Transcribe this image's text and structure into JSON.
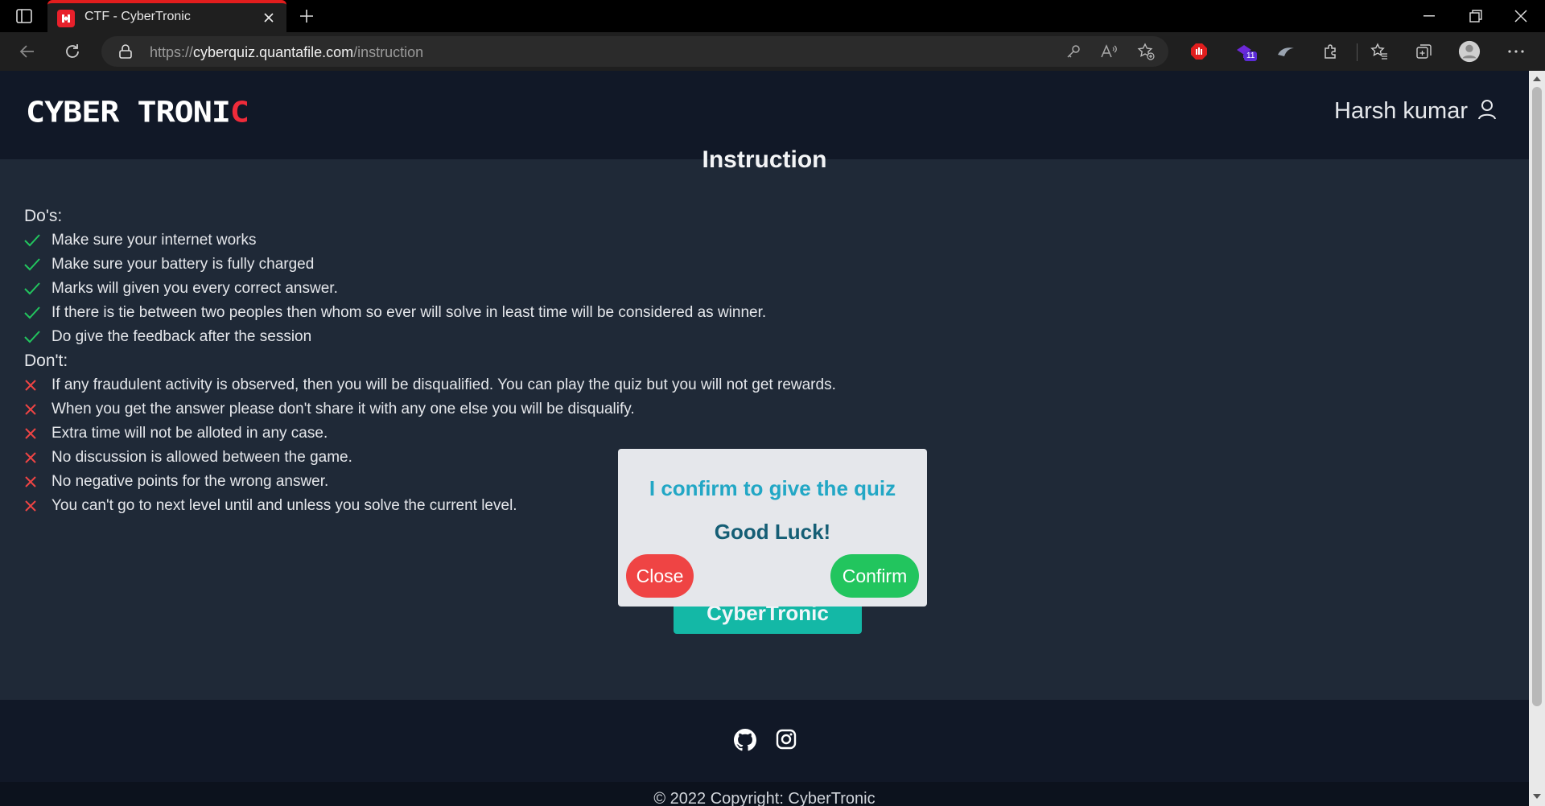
{
  "browser": {
    "tab_title": "CTF - CyberTronic",
    "url_scheme": "https://",
    "url_host": "cyberquiz.quantafile.com",
    "url_path": "/instruction",
    "extension_badge": "11"
  },
  "header": {
    "logo_white": "CYBER TRONI",
    "logo_red": "C",
    "user_name": "Harsh kumar"
  },
  "main": {
    "title": "Instruction",
    "dos_label": "Do's:",
    "dos": [
      "Make sure your internet works",
      "Make sure your battery is fully charged",
      "Marks will given you every correct answer.",
      "If there is tie between two peoples then whom so ever will solve in least time will be considered as winner.",
      "Do give the feedback after the session"
    ],
    "donts_label": "Don't:",
    "donts": [
      "If any fraudulent activity is observed, then you will be disqualified. You can play the quiz but you will not get rewards.",
      "When you get the answer please don't share it with any one else you will be disqualify.",
      "Extra time will not be alloted in any case.",
      "No discussion is allowed between the game.",
      "No negative points for the wrong answer.",
      "You can't go to next level until and unless you solve the current level."
    ],
    "start_button": "CyberTronic"
  },
  "modal": {
    "title": "I confirm to give the quiz",
    "subtitle": "Good Luck!",
    "close_label": "Close",
    "confirm_label": "Confirm"
  },
  "footer": {
    "copyright": "© 2022 Copyright:  CyberTronic"
  },
  "colors": {
    "check": "#22c55e",
    "cross": "#ef4444",
    "accent_teal": "#14b8a6"
  }
}
